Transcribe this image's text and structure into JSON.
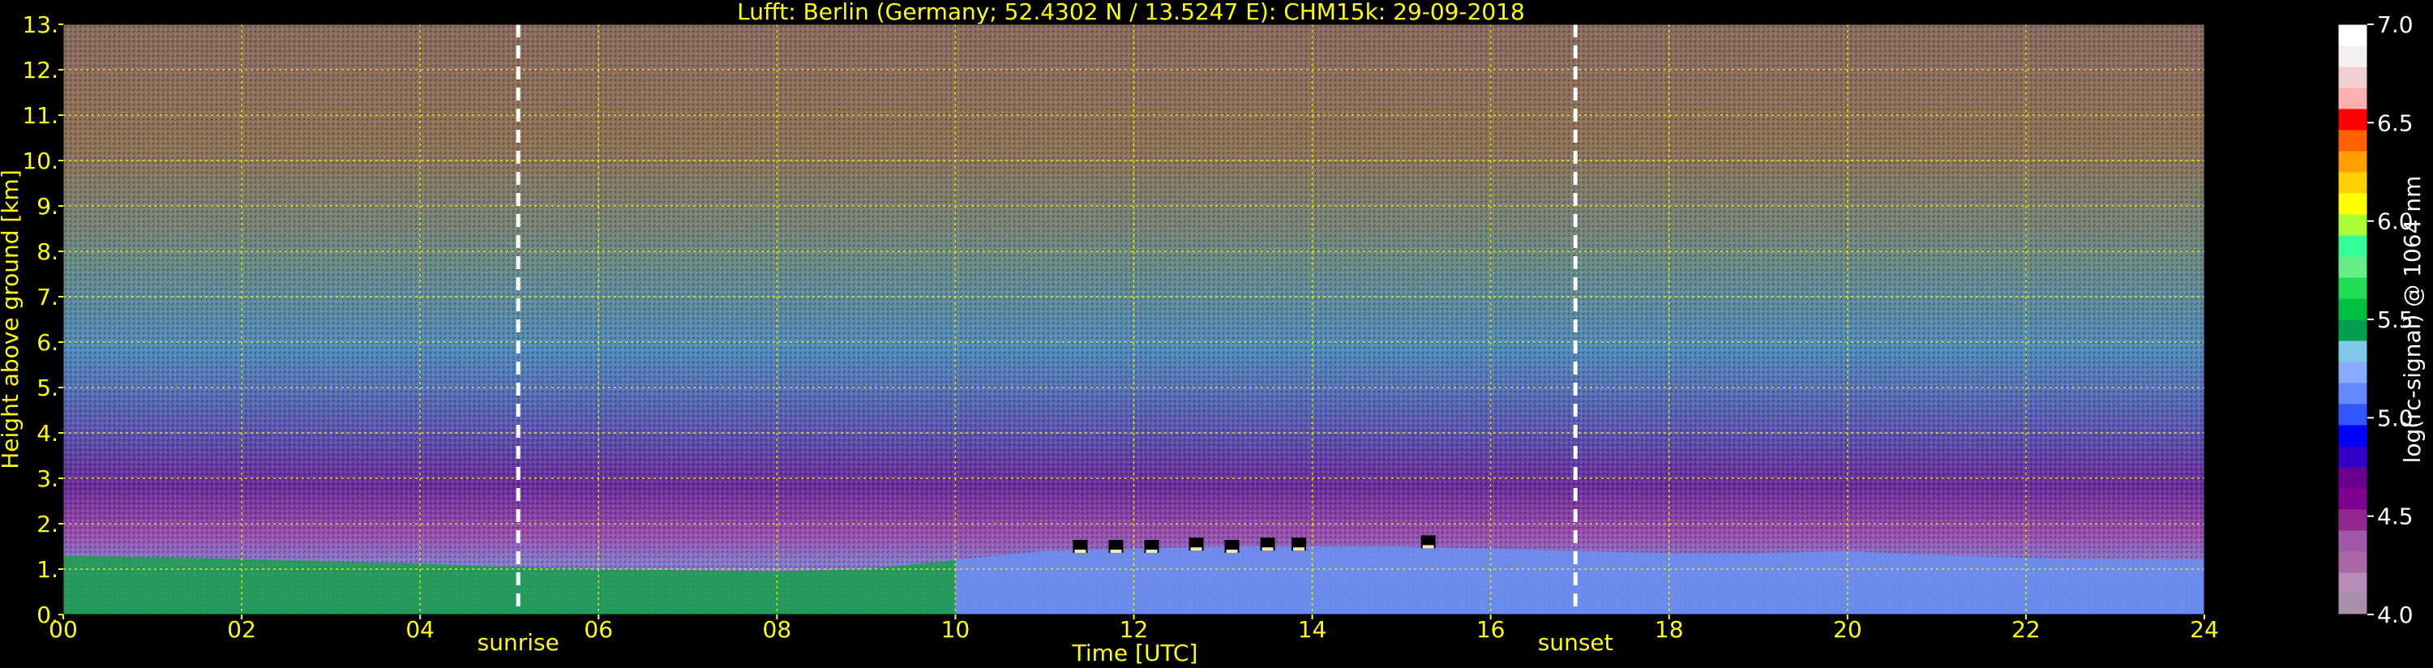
{
  "chart_data": {
    "type": "heatmap",
    "title": "Lufft: Berlin (Germany; 52.4302 N / 13.5247 E):    CHM15k: 29-09-2018",
    "xlabel": "Time [UTC]",
    "ylabel": "Height above ground [km]",
    "xlim": [
      0,
      24
    ],
    "ylim": [
      0,
      13
    ],
    "x_ticks": [
      "00",
      "02",
      "04",
      "06",
      "08",
      "10",
      "12",
      "14",
      "16",
      "18",
      "20",
      "22",
      "24"
    ],
    "y_ticks": [
      "0.",
      "1.",
      "2.",
      "3.",
      "4.",
      "5.",
      "6.",
      "7.",
      "8.",
      "9.",
      "10.",
      "11.",
      "12.",
      "13."
    ],
    "grid": true,
    "annotations": [
      {
        "label": "sunrise",
        "x": 5.1
      },
      {
        "label": "sunset",
        "x": 16.95
      }
    ],
    "boundary_layer_top_km": [
      [
        0,
        1.3
      ],
      [
        2,
        1.22
      ],
      [
        4,
        1.12
      ],
      [
        5,
        1.05
      ],
      [
        6,
        1.0
      ],
      [
        8,
        0.95
      ],
      [
        9,
        1.0
      ],
      [
        10,
        1.2
      ],
      [
        11,
        1.4
      ],
      [
        12,
        1.45
      ],
      [
        13,
        1.5
      ],
      [
        14,
        1.5
      ],
      [
        15,
        1.5
      ],
      [
        16,
        1.45
      ],
      [
        17,
        1.4
      ],
      [
        18,
        1.35
      ],
      [
        19,
        1.35
      ],
      [
        20,
        1.4
      ],
      [
        21,
        1.3
      ],
      [
        22,
        1.25
      ],
      [
        23,
        1.2
      ],
      [
        24,
        1.2
      ]
    ],
    "clouds_km": [
      {
        "x": 11.4,
        "y": 1.5
      },
      {
        "x": 11.8,
        "y": 1.5
      },
      {
        "x": 12.2,
        "y": 1.5
      },
      {
        "x": 12.7,
        "y": 1.55
      },
      {
        "x": 13.1,
        "y": 1.5
      },
      {
        "x": 13.5,
        "y": 1.55
      },
      {
        "x": 13.85,
        "y": 1.55
      },
      {
        "x": 15.3,
        "y": 1.6
      }
    ],
    "colorbar": {
      "label": "log(rc-signal) @ 1064 nm",
      "min": 4.0,
      "max": 7.0,
      "ticks": [
        "4.0",
        "4.5",
        "5.0",
        "5.5",
        "6.0",
        "6.5",
        "7.0"
      ],
      "colors": [
        "#a890a8",
        "#b88cb8",
        "#a868a8",
        "#a058a8",
        "#902890",
        "#800090",
        "#6a0090",
        "#3000c8",
        "#0000ff",
        "#3355ff",
        "#6688ff",
        "#88aaff",
        "#80c8e8",
        "#00a050",
        "#00c040",
        "#22dd55",
        "#66ee88",
        "#33ff99",
        "#aaff33",
        "#ffff00",
        "#ffd000",
        "#ffa000",
        "#ff6000",
        "#ff0000",
        "#ffb0b0",
        "#f0d0d0",
        "#f4f0f4",
        "#ffffff"
      ]
    }
  },
  "colors": {
    "background": "#000000",
    "text": "#ffff00",
    "grid": "#ffff00",
    "sun_lines": "#ffffff",
    "colorbar_text": "#ffffff"
  }
}
